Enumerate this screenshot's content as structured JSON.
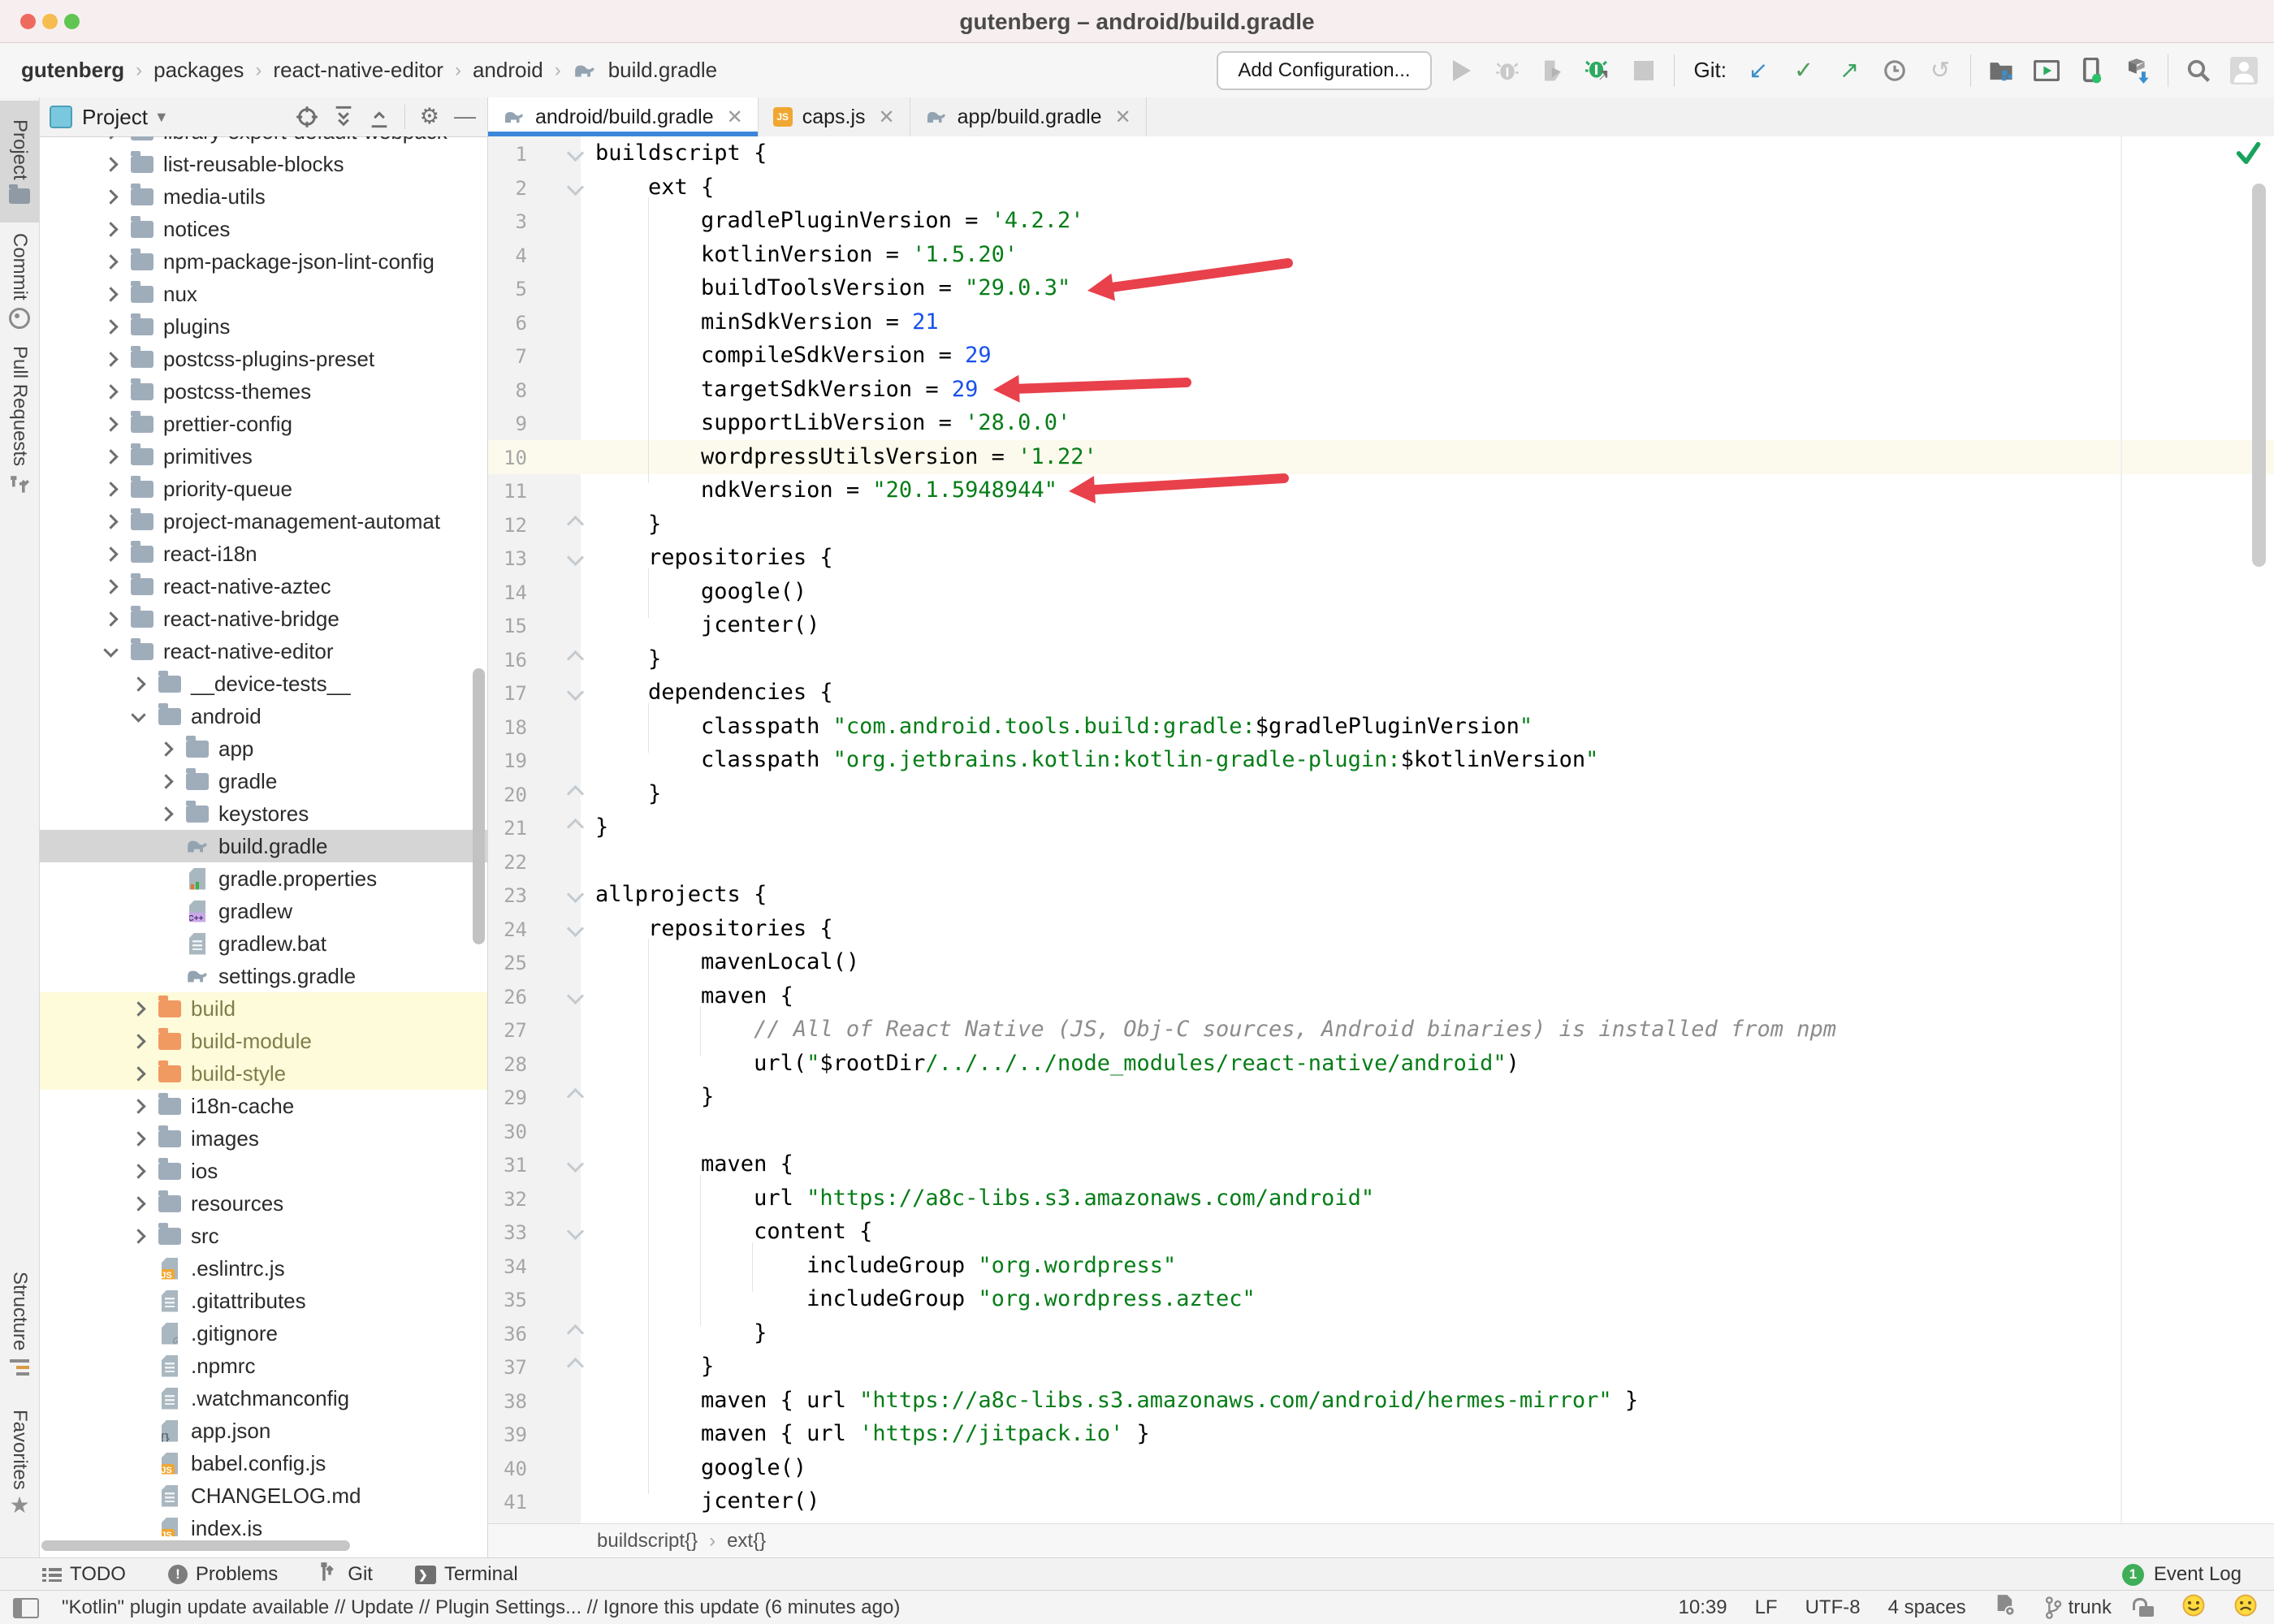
{
  "window": {
    "title": "gutenberg – android/build.gradle"
  },
  "nav_breadcrumbs": {
    "items": [
      "gutenberg",
      "packages",
      "react-native-editor",
      "android",
      "build.gradle"
    ]
  },
  "toolbar": {
    "add_configuration_label": "Add Configuration...",
    "git_label": "Git:"
  },
  "left_stripe": {
    "top": [
      "Project",
      "Commit",
      "Pull Requests"
    ],
    "bottom": [
      "Structure",
      "Favorites"
    ]
  },
  "project_panel": {
    "title": "Project"
  },
  "editor_tabs": [
    {
      "label": "android/build.gradle",
      "icon": "gradle",
      "active": true
    },
    {
      "label": "caps.js",
      "icon": "js",
      "active": false
    },
    {
      "label": "app/build.gradle",
      "icon": "gradle",
      "active": false
    }
  ],
  "project_tree": {
    "items": [
      {
        "label": "library-export-default-webpack",
        "level": 1,
        "expander": "closed",
        "icon": "folder",
        "partial": "top"
      },
      {
        "label": "list-reusable-blocks",
        "level": 1,
        "expander": "closed",
        "icon": "folder"
      },
      {
        "label": "media-utils",
        "level": 1,
        "expander": "closed",
        "icon": "folder"
      },
      {
        "label": "notices",
        "level": 1,
        "expander": "closed",
        "icon": "folder"
      },
      {
        "label": "npm-package-json-lint-config",
        "level": 1,
        "expander": "closed",
        "icon": "folder"
      },
      {
        "label": "nux",
        "level": 1,
        "expander": "closed",
        "icon": "folder"
      },
      {
        "label": "plugins",
        "level": 1,
        "expander": "closed",
        "icon": "folder"
      },
      {
        "label": "postcss-plugins-preset",
        "level": 1,
        "expander": "closed",
        "icon": "folder"
      },
      {
        "label": "postcss-themes",
        "level": 1,
        "expander": "closed",
        "icon": "folder"
      },
      {
        "label": "prettier-config",
        "level": 1,
        "expander": "closed",
        "icon": "folder"
      },
      {
        "label": "primitives",
        "level": 1,
        "expander": "closed",
        "icon": "folder"
      },
      {
        "label": "priority-queue",
        "level": 1,
        "expander": "closed",
        "icon": "folder"
      },
      {
        "label": "project-management-automat",
        "level": 1,
        "expander": "closed",
        "icon": "folder"
      },
      {
        "label": "react-i18n",
        "level": 1,
        "expander": "closed",
        "icon": "folder"
      },
      {
        "label": "react-native-aztec",
        "level": 1,
        "expander": "closed",
        "icon": "folder"
      },
      {
        "label": "react-native-bridge",
        "level": 1,
        "expander": "closed",
        "icon": "folder"
      },
      {
        "label": "react-native-editor",
        "level": 1,
        "expander": "open",
        "icon": "folder"
      },
      {
        "label": "__device-tests__",
        "level": 2,
        "expander": "closed",
        "icon": "folder"
      },
      {
        "label": "android",
        "level": 2,
        "expander": "open",
        "icon": "folder"
      },
      {
        "label": "app",
        "level": 3,
        "expander": "closed",
        "icon": "folder"
      },
      {
        "label": "gradle",
        "level": 3,
        "expander": "closed",
        "icon": "folder"
      },
      {
        "label": "keystores",
        "level": 3,
        "expander": "closed",
        "icon": "folder"
      },
      {
        "label": "build.gradle",
        "level": 3,
        "icon": "gradle",
        "selected": true
      },
      {
        "label": "gradle.properties",
        "level": 3,
        "icon": "properties"
      },
      {
        "label": "gradlew",
        "level": 3,
        "icon": "cpp"
      },
      {
        "label": "gradlew.bat",
        "level": 3,
        "icon": "text"
      },
      {
        "label": "settings.gradle",
        "level": 3,
        "icon": "gradle"
      },
      {
        "label": "build",
        "level": 2,
        "expander": "closed",
        "icon": "folder-excluded",
        "excluded": true
      },
      {
        "label": "build-module",
        "level": 2,
        "expander": "closed",
        "icon": "folder-excluded",
        "excluded": true
      },
      {
        "label": "build-style",
        "level": 2,
        "expander": "closed",
        "icon": "folder-excluded",
        "excluded": true
      },
      {
        "label": "i18n-cache",
        "level": 2,
        "expander": "closed",
        "icon": "folder"
      },
      {
        "label": "images",
        "level": 2,
        "expander": "closed",
        "icon": "folder"
      },
      {
        "label": "ios",
        "level": 2,
        "expander": "closed",
        "icon": "folder"
      },
      {
        "label": "resources",
        "level": 2,
        "expander": "closed",
        "icon": "folder"
      },
      {
        "label": "src",
        "level": 2,
        "expander": "closed",
        "icon": "folder"
      },
      {
        "label": ".eslintrc.js",
        "level": 2,
        "icon": "js"
      },
      {
        "label": ".gitattributes",
        "level": 2,
        "icon": "text"
      },
      {
        "label": ".gitignore",
        "level": 2,
        "icon": "ignored"
      },
      {
        "label": ".npmrc",
        "level": 2,
        "icon": "text"
      },
      {
        "label": ".watchmanconfig",
        "level": 2,
        "icon": "text"
      },
      {
        "label": "app.json",
        "level": 2,
        "icon": "json"
      },
      {
        "label": "babel.config.js",
        "level": 2,
        "icon": "js"
      },
      {
        "label": "CHANGELOG.md",
        "level": 2,
        "icon": "text"
      },
      {
        "label": "index.js",
        "level": 2,
        "icon": "js",
        "partial": "bottom"
      }
    ]
  },
  "editor": {
    "lines": [
      {
        "n": 1,
        "fold": "open",
        "tokens": [
          [
            "d",
            "buildscript {"
          ]
        ]
      },
      {
        "n": 2,
        "fold": "open",
        "tokens": [
          [
            "d",
            "    ext {"
          ]
        ]
      },
      {
        "n": 3,
        "tokens": [
          [
            "d",
            "        gradlePluginVersion = "
          ],
          [
            "s",
            "'4.2.2'"
          ]
        ]
      },
      {
        "n": 4,
        "tokens": [
          [
            "d",
            "        kotlinVersion = "
          ],
          [
            "s",
            "'1.5.20'"
          ]
        ]
      },
      {
        "n": 5,
        "tokens": [
          [
            "d",
            "        buildToolsVersion = "
          ],
          [
            "s",
            "\"29.0.3\""
          ]
        ]
      },
      {
        "n": 6,
        "tokens": [
          [
            "d",
            "        minSdkVersion = "
          ],
          [
            "n",
            "21"
          ]
        ]
      },
      {
        "n": 7,
        "tokens": [
          [
            "d",
            "        compileSdkVersion = "
          ],
          [
            "n",
            "29"
          ]
        ]
      },
      {
        "n": 8,
        "tokens": [
          [
            "d",
            "        targetSdkVersion = "
          ],
          [
            "n",
            "29"
          ]
        ]
      },
      {
        "n": 9,
        "tokens": [
          [
            "d",
            "        supportLibVersion = "
          ],
          [
            "s",
            "'28.0.0'"
          ]
        ]
      },
      {
        "n": 10,
        "hl": true,
        "tokens": [
          [
            "d",
            "        wordpressUtilsVersion = "
          ],
          [
            "s",
            "'1.22'"
          ]
        ]
      },
      {
        "n": 11,
        "tokens": [
          [
            "d",
            "        ndkVersion = "
          ],
          [
            "s",
            "\"20.1.5948944\""
          ]
        ]
      },
      {
        "n": 12,
        "fold": "close",
        "tokens": [
          [
            "d",
            "    }"
          ]
        ]
      },
      {
        "n": 13,
        "fold": "open",
        "tokens": [
          [
            "d",
            "    repositories {"
          ]
        ]
      },
      {
        "n": 14,
        "tokens": [
          [
            "d",
            "        google()"
          ]
        ]
      },
      {
        "n": 15,
        "tokens": [
          [
            "d",
            "        jcenter()"
          ]
        ]
      },
      {
        "n": 16,
        "fold": "close",
        "tokens": [
          [
            "d",
            "    }"
          ]
        ]
      },
      {
        "n": 17,
        "fold": "open",
        "tokens": [
          [
            "d",
            "    dependencies {"
          ]
        ]
      },
      {
        "n": 18,
        "tokens": [
          [
            "d",
            "        classpath "
          ],
          [
            "s",
            "\"com.android.tools.build:gradle:"
          ],
          [
            "d",
            "$gradlePluginVersion"
          ],
          [
            "s",
            "\""
          ]
        ]
      },
      {
        "n": 19,
        "tokens": [
          [
            "d",
            "        classpath "
          ],
          [
            "s",
            "\"org.jetbrains.kotlin:kotlin-gradle-plugin:"
          ],
          [
            "d",
            "$kotlinVersion"
          ],
          [
            "s",
            "\""
          ]
        ]
      },
      {
        "n": 20,
        "fold": "close",
        "tokens": [
          [
            "d",
            "    }"
          ]
        ]
      },
      {
        "n": 21,
        "fold": "close",
        "tokens": [
          [
            "d",
            "}"
          ]
        ]
      },
      {
        "n": 22,
        "tokens": []
      },
      {
        "n": 23,
        "fold": "open",
        "tokens": [
          [
            "d",
            "allprojects {"
          ]
        ]
      },
      {
        "n": 24,
        "fold": "open",
        "tokens": [
          [
            "d",
            "    repositories {"
          ]
        ]
      },
      {
        "n": 25,
        "tokens": [
          [
            "d",
            "        mavenLocal()"
          ]
        ]
      },
      {
        "n": 26,
        "fold": "open",
        "tokens": [
          [
            "d",
            "        maven {"
          ]
        ]
      },
      {
        "n": 27,
        "tokens": [
          [
            "c",
            "            // All of React Native (JS, Obj-C sources, Android binaries) is installed from npm"
          ]
        ]
      },
      {
        "n": 28,
        "tokens": [
          [
            "d",
            "            url("
          ],
          [
            "s",
            "\""
          ],
          [
            "d",
            "$rootDir"
          ],
          [
            "s",
            "/../../../node_modules/react-native/android\""
          ],
          [
            "d",
            ")"
          ]
        ]
      },
      {
        "n": 29,
        "fold": "close",
        "tokens": [
          [
            "d",
            "        }"
          ]
        ]
      },
      {
        "n": 30,
        "tokens": []
      },
      {
        "n": 31,
        "fold": "open",
        "tokens": [
          [
            "d",
            "        maven {"
          ]
        ]
      },
      {
        "n": 32,
        "tokens": [
          [
            "d",
            "            url "
          ],
          [
            "s",
            "\"https://a8c-libs.s3.amazonaws.com/android\""
          ]
        ]
      },
      {
        "n": 33,
        "fold": "open",
        "tokens": [
          [
            "d",
            "            content {"
          ]
        ]
      },
      {
        "n": 34,
        "tokens": [
          [
            "d",
            "                includeGroup "
          ],
          [
            "s",
            "\"org.wordpress\""
          ]
        ]
      },
      {
        "n": 35,
        "tokens": [
          [
            "d",
            "                includeGroup "
          ],
          [
            "s",
            "\"org.wordpress.aztec\""
          ]
        ]
      },
      {
        "n": 36,
        "fold": "close",
        "tokens": [
          [
            "d",
            "            }"
          ]
        ]
      },
      {
        "n": 37,
        "fold": "close",
        "tokens": [
          [
            "d",
            "        }"
          ]
        ]
      },
      {
        "n": 38,
        "tokens": [
          [
            "d",
            "        maven { url "
          ],
          [
            "s",
            "\"https://a8c-libs.s3.amazonaws.com/android/hermes-mirror\""
          ],
          [
            "d",
            " }"
          ]
        ]
      },
      {
        "n": 39,
        "tokens": [
          [
            "d",
            "        maven { url "
          ],
          [
            "s",
            "'https://jitpack.io'"
          ],
          [
            "d",
            " }"
          ]
        ]
      },
      {
        "n": 40,
        "tokens": [
          [
            "d",
            "        google()"
          ]
        ]
      },
      {
        "n": 41,
        "tokens": [
          [
            "d",
            "        jcenter()"
          ]
        ]
      }
    ],
    "annotations": [
      {
        "type": "red-arrow",
        "points_at": "buildToolsVersion = \"29.0.3\"",
        "line": 5
      },
      {
        "type": "red-arrow",
        "points_at": "targetSdkVersion = 29",
        "line": 8
      },
      {
        "type": "red-arrow",
        "points_at": "ndkVersion = \"20.1.5948944\"",
        "line": 11
      }
    ],
    "inspection_status": "ok"
  },
  "editor_breadcrumb": {
    "items": [
      "buildscript{}",
      "ext{}"
    ]
  },
  "bottom_tool_bar": {
    "left": [
      {
        "label": "TODO"
      },
      {
        "label": "Problems"
      },
      {
        "label": "Git"
      },
      {
        "label": "Terminal"
      }
    ],
    "event_log_label": "Event Log",
    "event_log_badge": "1"
  },
  "status_bar": {
    "message": "\"Kotlin\" plugin update available // Update // Plugin Settings... // Ignore this update (6 minutes ago)",
    "caret_position": "10:39",
    "line_ending": "LF",
    "encoding": "UTF-8",
    "indent": "4 spaces",
    "branch": "trunk"
  },
  "colors": {
    "tab_accent": "#3b86d9",
    "string_green": "#067d17",
    "number_blue": "#1750eb",
    "comment_gray": "#8c8c8c",
    "arrow_red": "#e8414b",
    "selected_row": "#d5d5d5",
    "excluded_row": "#fdfbda",
    "active_line": "#fcfaed",
    "ok_check_green": "#17a35b"
  }
}
